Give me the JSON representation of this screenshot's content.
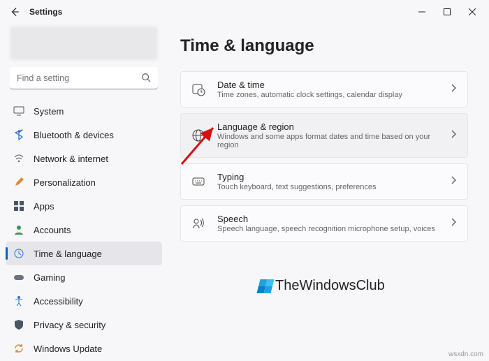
{
  "app": {
    "title": "Settings"
  },
  "search": {
    "placeholder": "Find a setting"
  },
  "sidebar": {
    "items": [
      {
        "label": "System"
      },
      {
        "label": "Bluetooth & devices"
      },
      {
        "label": "Network & internet"
      },
      {
        "label": "Personalization"
      },
      {
        "label": "Apps"
      },
      {
        "label": "Accounts"
      },
      {
        "label": "Time & language"
      },
      {
        "label": "Gaming"
      },
      {
        "label": "Accessibility"
      },
      {
        "label": "Privacy & security"
      },
      {
        "label": "Windows Update"
      }
    ]
  },
  "page": {
    "title": "Time & language"
  },
  "cards": [
    {
      "title": "Date & time",
      "desc": "Time zones, automatic clock settings, calendar display"
    },
    {
      "title": "Language & region",
      "desc": "Windows and some apps format dates and time based on your region"
    },
    {
      "title": "Typing",
      "desc": "Touch keyboard, text suggestions, preferences"
    },
    {
      "title": "Speech",
      "desc": "Speech language, speech recognition microphone setup, voices"
    }
  ],
  "watermark": {
    "text": "TheWindowsClub"
  },
  "attribution": "wsxdn.com"
}
